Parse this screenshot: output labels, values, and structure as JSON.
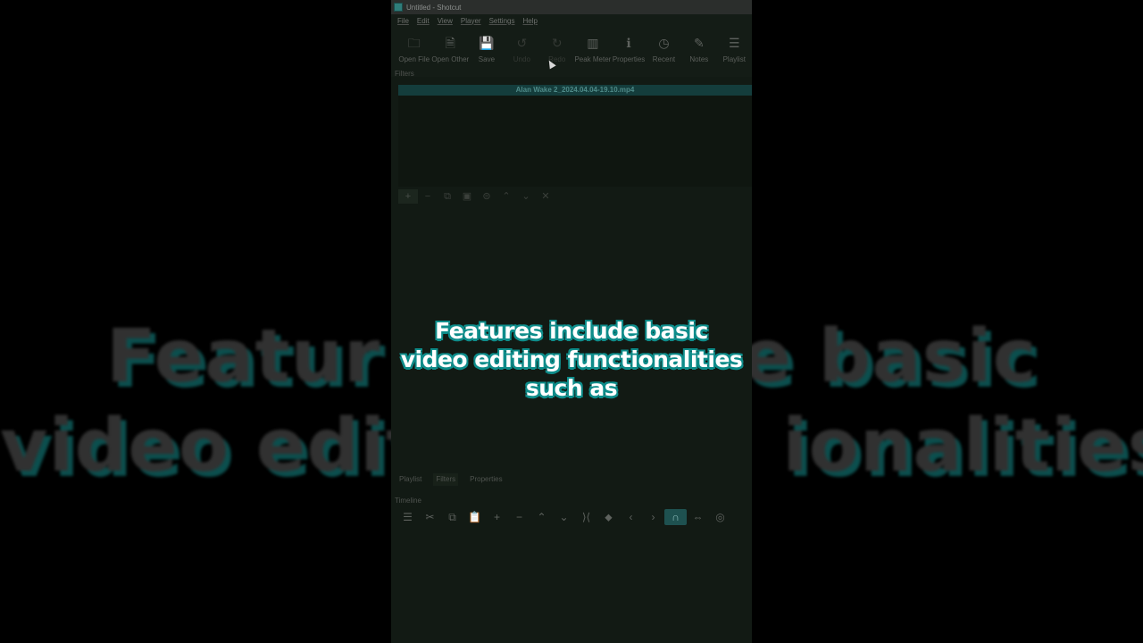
{
  "window": {
    "title": "Untitled - Shotcut"
  },
  "menu": [
    "File",
    "Edit",
    "View",
    "Player",
    "Settings",
    "Help"
  ],
  "toolbar": [
    {
      "label": "Open File",
      "icon": "folder-open-icon",
      "glyph": "🗀",
      "disabled": false
    },
    {
      "label": "Open Other",
      "icon": "open-other-icon",
      "glyph": "🗎",
      "disabled": false
    },
    {
      "label": "Save",
      "icon": "save-icon",
      "glyph": "💾",
      "disabled": false
    },
    {
      "label": "Undo",
      "icon": "undo-icon",
      "glyph": "↺",
      "disabled": true
    },
    {
      "label": "Redo",
      "icon": "redo-icon",
      "glyph": "↻",
      "disabled": true
    },
    {
      "label": "Peak Meter",
      "icon": "peak-meter-icon",
      "glyph": "▥",
      "disabled": false
    },
    {
      "label": "Properties",
      "icon": "info-icon",
      "glyph": "ℹ",
      "disabled": false
    },
    {
      "label": "Recent",
      "icon": "clock-icon",
      "glyph": "◷",
      "disabled": false
    },
    {
      "label": "Notes",
      "icon": "notes-icon",
      "glyph": "✎",
      "disabled": false
    },
    {
      "label": "Playlist",
      "icon": "list-icon",
      "glyph": "☰",
      "disabled": false
    }
  ],
  "filters_panel": {
    "label": "Filters",
    "clip_name": "Alan Wake 2_2024.04.04-19.10.mp4"
  },
  "filter_tool_glyphs": [
    "+",
    "−",
    "⧉",
    "▣",
    "⊜",
    "⌃",
    "⌄",
    "✕"
  ],
  "caption": {
    "line1": "Features include basic",
    "line2": "video editing functionalities",
    "line3": "such as"
  },
  "background_caption": {
    "line1": "Featur",
    "line1b": "e basic",
    "line2": "video edit",
    "line2b": "ionalities"
  },
  "tabs": [
    "Playlist",
    "Filters",
    "Properties"
  ],
  "timeline": {
    "label": "Timeline",
    "tools": [
      "☰",
      "✂",
      "⧉",
      "📋",
      "+",
      "−",
      "⌃",
      "⌄",
      "⟩⟨",
      "⬥",
      "‹",
      "›",
      "∩",
      "⇔",
      "◎"
    ]
  },
  "colors": {
    "accent": "#0e8c8a",
    "clip_bar": "#143d3c",
    "window_bg": "#121a14"
  }
}
